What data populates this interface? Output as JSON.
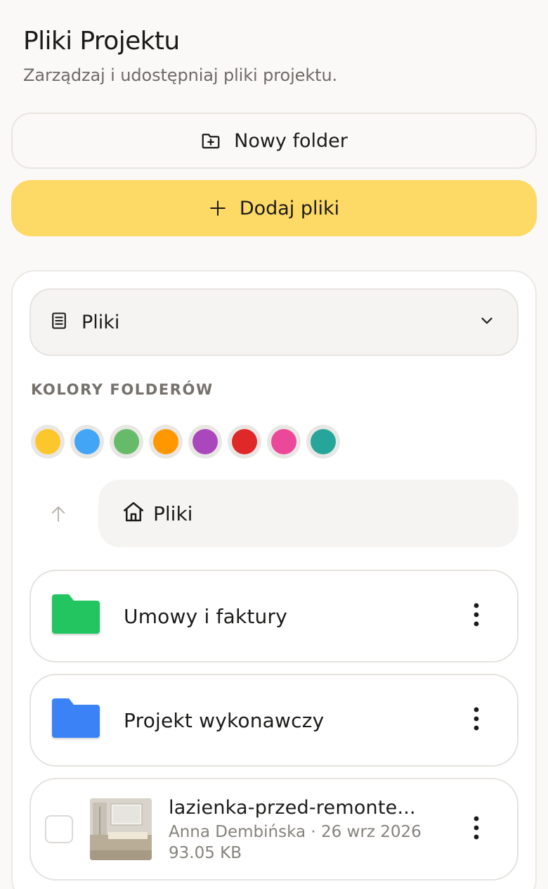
{
  "header": {
    "title": "Pliki Projektu",
    "subtitle": "Zarządzaj i udostępniaj pliki projektu."
  },
  "actions": {
    "new_folder_label": "Nowy folder",
    "add_files_label": "Dodaj pliki"
  },
  "view_select": {
    "selected": "Pliki",
    "icon": "document-icon"
  },
  "folder_colors": {
    "label": "KOLORY FOLDERÓW",
    "colors": [
      "#fcc72a",
      "#42a5f5",
      "#66bb6a",
      "#ff9800",
      "#ab47bc",
      "#e02828",
      "#ec4899",
      "#26a69a"
    ]
  },
  "breadcrumb": {
    "label": "Pliki",
    "icon": "home-icon"
  },
  "items": [
    {
      "type": "folder",
      "name": "Umowy i faktury",
      "color": "#22c55e"
    },
    {
      "type": "folder",
      "name": "Projekt wykonawczy",
      "color": "#3b82f6"
    },
    {
      "type": "file",
      "name": "lazienka-przed-remonte...",
      "author_date": "Anna Dembińska · 26 wrz 2026",
      "size": "93.05 KB"
    }
  ]
}
